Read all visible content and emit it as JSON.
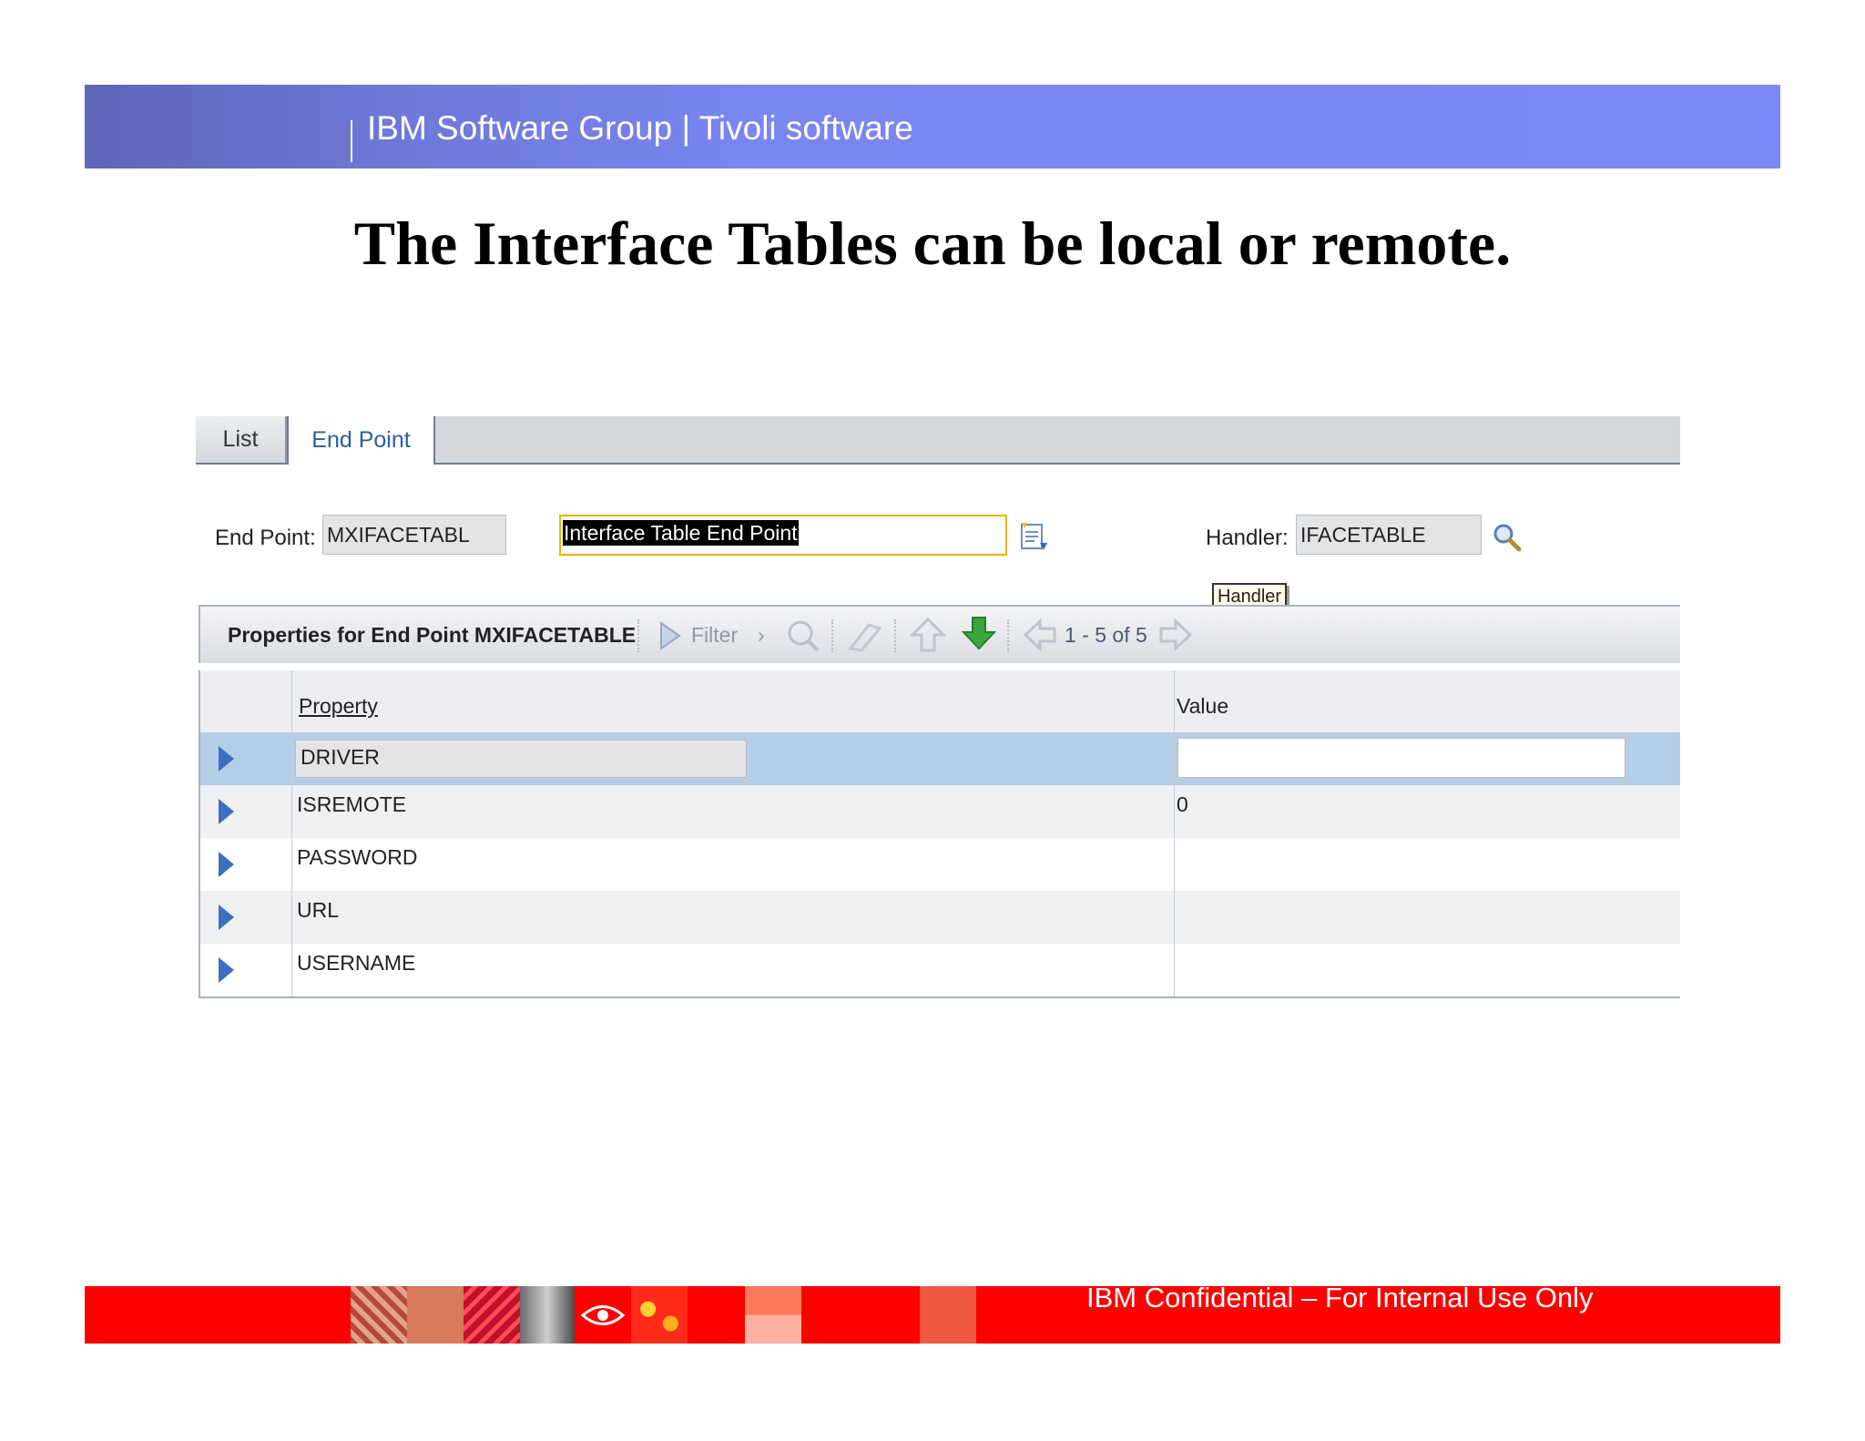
{
  "header": {
    "banner_text": "IBM Software Group | Tivoli software",
    "title": "The Interface Tables can be local or remote."
  },
  "tabs": [
    {
      "label": "List"
    },
    {
      "label": "End Point"
    }
  ],
  "form": {
    "endpoint_label": "End Point:",
    "endpoint_value": "MXIFACETABL",
    "description_value": "Interface Table End Point",
    "handler_label": "Handler:",
    "handler_value": "IFACETABLE",
    "tooltip": "Handler"
  },
  "table": {
    "title": "Properties for End Point MXIFACETABLE",
    "filter_label": "Filter",
    "pagination": "1 - 5 of 5",
    "columns": [
      "Property",
      "Value"
    ],
    "rows": [
      {
        "property": "DRIVER",
        "value": ""
      },
      {
        "property": "ISREMOTE",
        "value": "0"
      },
      {
        "property": "PASSWORD",
        "value": ""
      },
      {
        "property": "URL",
        "value": ""
      },
      {
        "property": "USERNAME",
        "value": ""
      }
    ]
  },
  "footer": {
    "text": "IBM Confidential – For Internal Use Only"
  },
  "colors": {
    "banner": "#7c88f6",
    "footer": "#ff0000",
    "selected_row": "#b6cde6",
    "row_arrow": "#3b6fc4"
  }
}
